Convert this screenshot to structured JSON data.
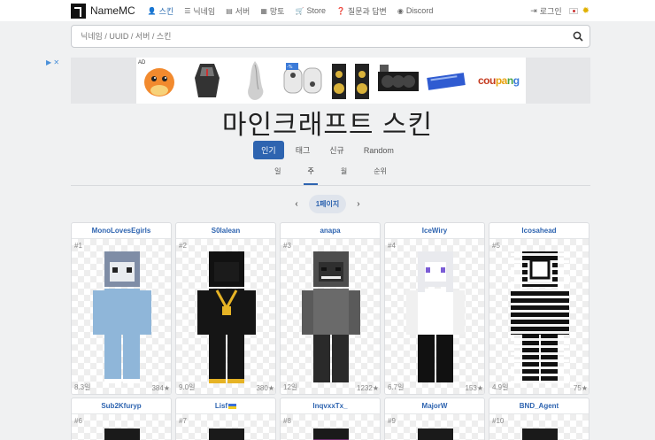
{
  "nav": {
    "brand": "NameMC",
    "links": [
      {
        "icon": "user-icon",
        "glyph": "👤",
        "label": "스킨",
        "active": true
      },
      {
        "icon": "list-icon",
        "glyph": "☰",
        "label": "닉네임",
        "active": false
      },
      {
        "icon": "server-icon",
        "glyph": "▤",
        "label": "서버",
        "active": false
      },
      {
        "icon": "cape-icon",
        "glyph": "▦",
        "label": "망토",
        "active": false
      },
      {
        "icon": "cart-icon",
        "glyph": "🛒",
        "label": "Store",
        "active": false
      },
      {
        "icon": "question-icon",
        "glyph": "❓",
        "label": "질문과 답변",
        "active": false
      },
      {
        "icon": "discord-icon",
        "glyph": "◉",
        "label": "Discord",
        "active": false
      }
    ],
    "login": "로그인"
  },
  "search": {
    "placeholder": "닉네임 / UUID / 서버 / 스킨"
  },
  "ads": {
    "label": "AD",
    "coupang": "coupang"
  },
  "title": "마인크래프트 스킨",
  "tabs": [
    {
      "label": "인기",
      "active": true
    },
    {
      "label": "태그",
      "active": false
    },
    {
      "label": "신규",
      "active": false
    },
    {
      "label": "Random",
      "active": false
    }
  ],
  "subtabs": [
    {
      "label": "일",
      "active": false
    },
    {
      "label": "주",
      "active": true
    },
    {
      "label": "월",
      "active": false
    },
    {
      "label": "순위",
      "active": false
    }
  ],
  "pager": {
    "current": "1페이지"
  },
  "skins": [
    {
      "name": "MonoLovesEgirls",
      "rank": "#1",
      "age": "8.3일",
      "stars": "384★"
    },
    {
      "name": "S0lalean",
      "rank": "#2",
      "age": "9.0일",
      "stars": "380★"
    },
    {
      "name": "anapa",
      "rank": "#3",
      "age": "12일",
      "stars": "1232★"
    },
    {
      "name": "IceWiry",
      "rank": "#4",
      "age": "6.7일",
      "stars": "153★"
    },
    {
      "name": "Icosahead",
      "rank": "#5",
      "age": "4.9일",
      "stars": "75★"
    },
    {
      "name": "Sub2Kfuryp",
      "rank": "#6"
    },
    {
      "name": "Lisf",
      "rank": "#7",
      "flag": true
    },
    {
      "name": "InqvxxTx_",
      "rank": "#8"
    },
    {
      "name": "MajorW",
      "rank": "#9"
    },
    {
      "name": "BND_Agent",
      "rank": "#10"
    }
  ]
}
